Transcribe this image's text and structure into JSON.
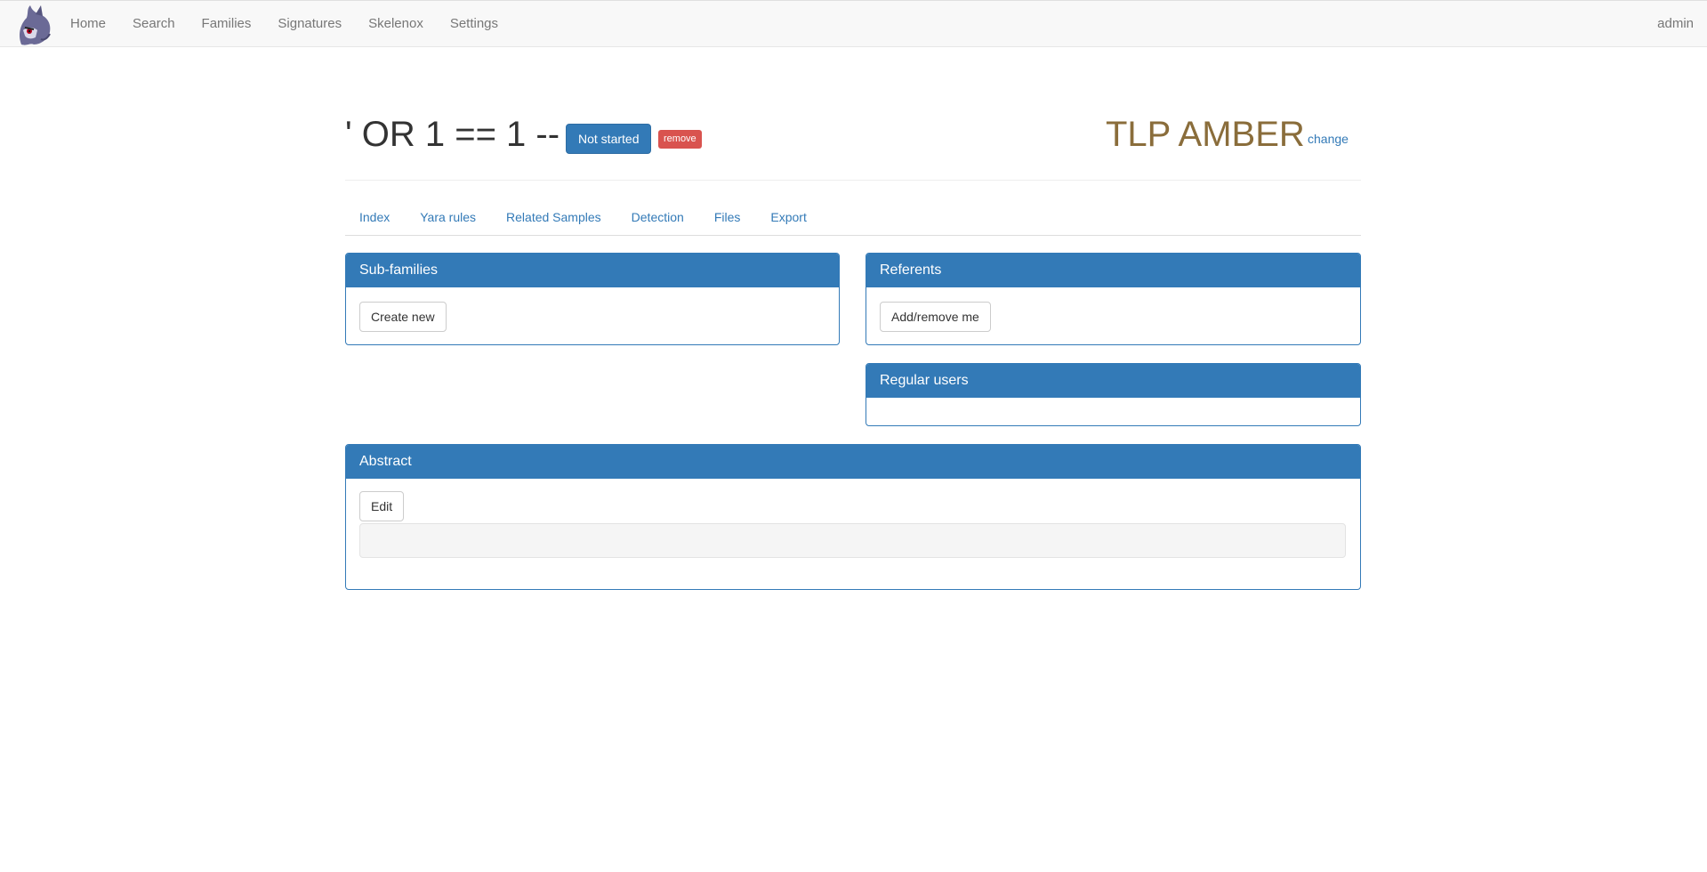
{
  "navbar": {
    "logo_icon": "ghost-mascot-icon",
    "links": [
      {
        "label": "Home"
      },
      {
        "label": "Search"
      },
      {
        "label": "Families"
      },
      {
        "label": "Signatures"
      },
      {
        "label": "Skelenox"
      },
      {
        "label": "Settings"
      }
    ],
    "user": "admin"
  },
  "header": {
    "title": "' OR 1 == 1 --",
    "status_label": "Not started",
    "remove_label": "remove",
    "tlp_label": "TLP AMBER",
    "tlp_color": "#8a6d3b",
    "change_label": "change"
  },
  "tabs": [
    {
      "label": "Index"
    },
    {
      "label": "Yara rules"
    },
    {
      "label": "Related Samples"
    },
    {
      "label": "Detection"
    },
    {
      "label": "Files"
    },
    {
      "label": "Export"
    }
  ],
  "panels": {
    "subfamilies": {
      "title": "Sub-families",
      "button": "Create new"
    },
    "referents": {
      "title": "Referents",
      "button": "Add/remove me"
    },
    "regular_users": {
      "title": "Regular users"
    },
    "abstract": {
      "title": "Abstract",
      "button": "Edit",
      "content": ""
    }
  },
  "colors": {
    "primary": "#337ab7",
    "danger": "#d9534f",
    "tlp_amber": "#8a6d3b"
  }
}
